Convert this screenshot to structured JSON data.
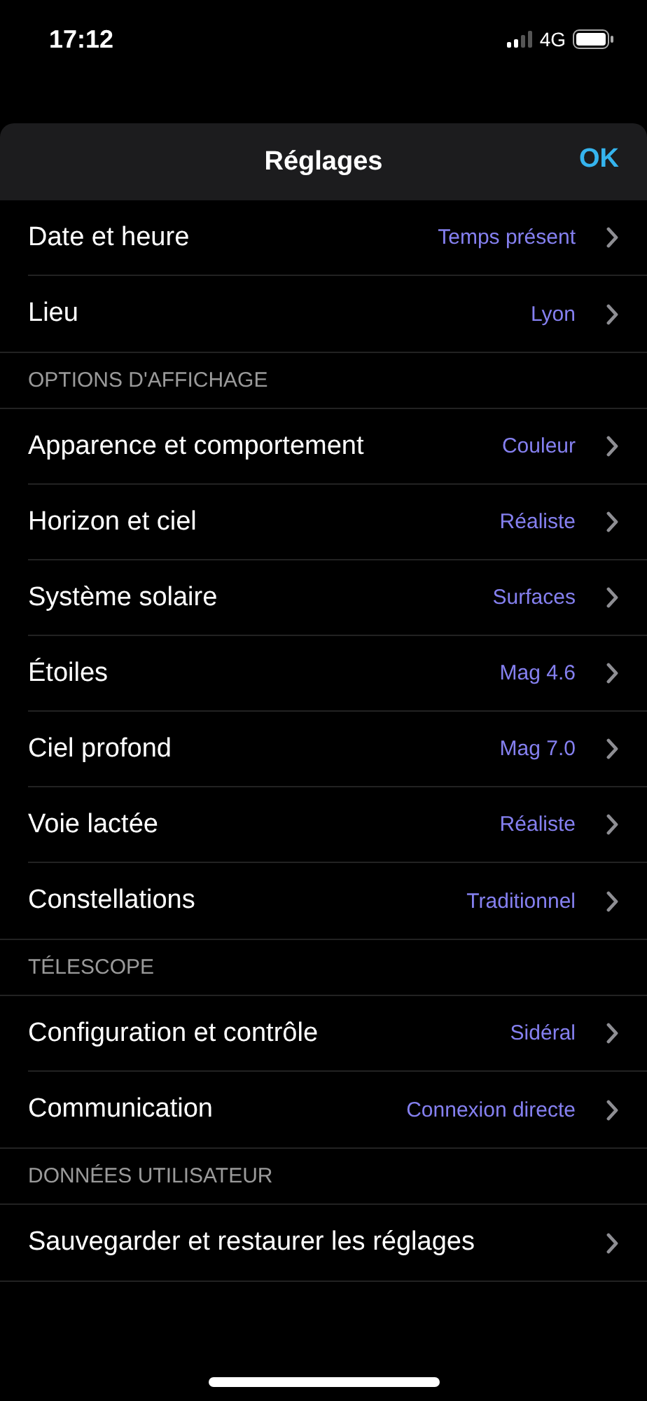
{
  "status_bar": {
    "time": "17:12",
    "network": "4G"
  },
  "header": {
    "title": "Réglages",
    "done_button": "OK"
  },
  "sections": [
    {
      "rows": [
        {
          "label": "Date et heure",
          "value": "Temps présent"
        },
        {
          "label": "Lieu",
          "value": "Lyon"
        }
      ]
    },
    {
      "header": "OPTIONS D'AFFICHAGE",
      "rows": [
        {
          "label": "Apparence et comportement",
          "value": "Couleur"
        },
        {
          "label": "Horizon et ciel",
          "value": "Réaliste"
        },
        {
          "label": "Système solaire",
          "value": "Surfaces"
        },
        {
          "label": "Étoiles",
          "value": "Mag 4.6"
        },
        {
          "label": "Ciel profond",
          "value": "Mag 7.0"
        },
        {
          "label": "Voie lactée",
          "value": "Réaliste"
        },
        {
          "label": "Constellations",
          "value": "Traditionnel"
        }
      ]
    },
    {
      "header": "TÉLESCOPE",
      "rows": [
        {
          "label": "Configuration et contrôle",
          "value": "Sidéral"
        },
        {
          "label": "Communication",
          "value": "Connexion directe"
        }
      ]
    },
    {
      "header": "DONNÉES UTILISATEUR",
      "rows": [
        {
          "label": "Sauvegarder et restaurer les réglages"
        }
      ]
    }
  ]
}
